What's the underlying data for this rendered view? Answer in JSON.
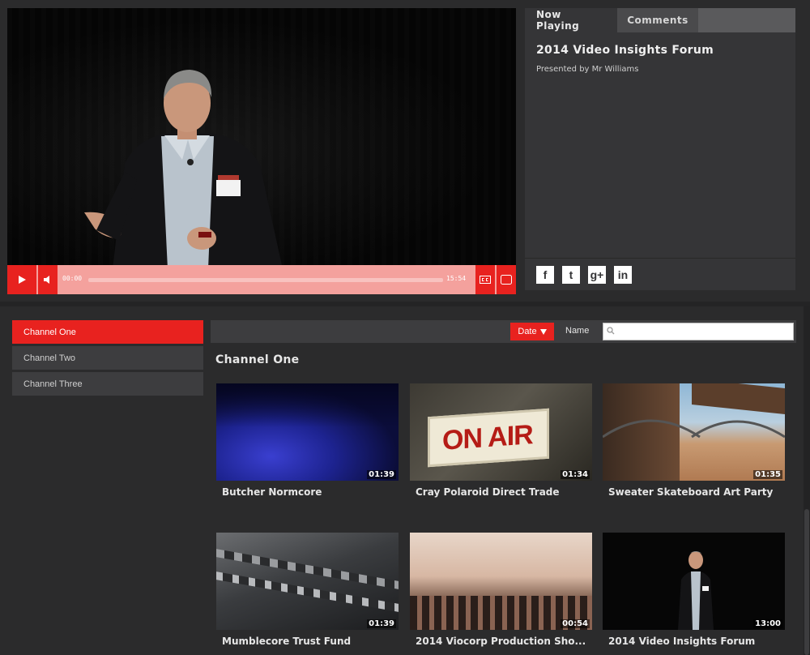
{
  "player": {
    "elapsed": "00:00",
    "total": "15:54",
    "progress": 0.0,
    "accent": "#e8221f"
  },
  "panel": {
    "tabs": [
      {
        "label": "Now Playing",
        "active": true
      },
      {
        "label": "Comments",
        "active": false
      }
    ],
    "title": "2014 Video Insights Forum",
    "presenter": "Presented by Mr Williams",
    "share": [
      {
        "icon": "facebook-icon",
        "glyph": "f"
      },
      {
        "icon": "twitter-icon",
        "glyph": "t"
      },
      {
        "icon": "google-plus-icon",
        "glyph": "g+"
      },
      {
        "icon": "linkedin-icon",
        "glyph": "in"
      }
    ]
  },
  "channels": {
    "items": [
      {
        "label": "Channel One",
        "active": true
      },
      {
        "label": "Channel Two",
        "active": false
      },
      {
        "label": "Channel Three",
        "active": false
      }
    ]
  },
  "filter": {
    "date_label": "Date",
    "name_label": "Name",
    "search_value": ""
  },
  "grid": {
    "heading": "Channel One",
    "videos": [
      {
        "title": "Butcher Normcore",
        "duration": "01:39"
      },
      {
        "title": "Cray Polaroid Direct Trade",
        "duration": "01:34"
      },
      {
        "title": "Sweater Skateboard Art Party",
        "duration": "01:35"
      },
      {
        "title": "Mumblecore Trust Fund",
        "duration": "01:39"
      },
      {
        "title": "2014 Viocorp Production Sho...",
        "duration": "00:54"
      },
      {
        "title": "2014 Video Insights Forum",
        "duration": "13:00"
      }
    ]
  }
}
